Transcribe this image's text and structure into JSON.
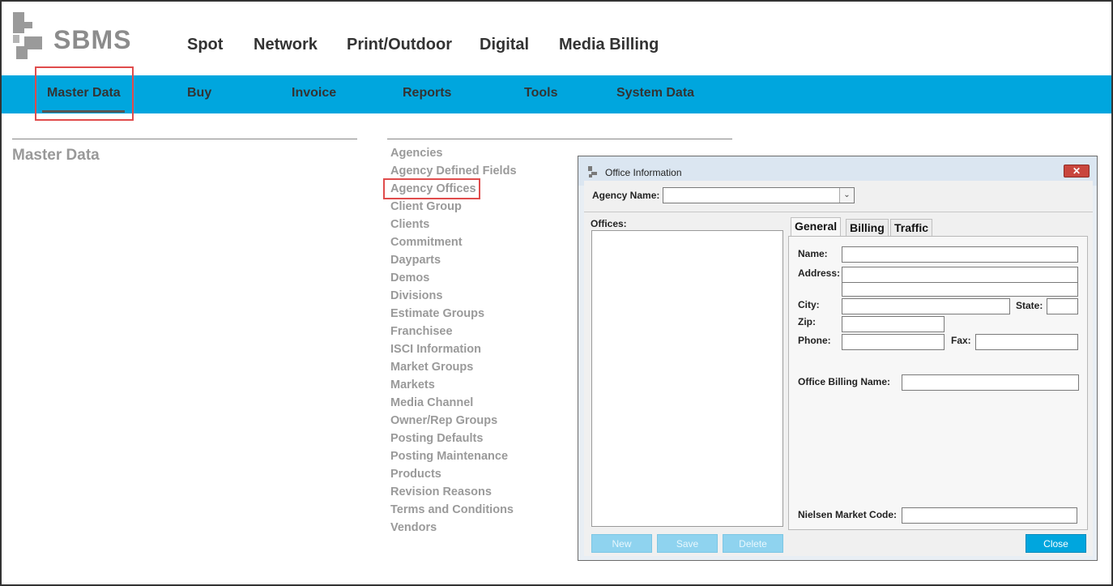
{
  "app": {
    "logo_text": "SBMS"
  },
  "topnav": [
    "Spot",
    "Network",
    "Print/Outdoor",
    "Digital",
    "Media Billing"
  ],
  "subnav": [
    "Master Data",
    "Buy",
    "Invoice",
    "Reports",
    "Tools",
    "System Data"
  ],
  "section_title": "Master Data",
  "menu": [
    "Agencies",
    "Agency Defined Fields",
    "Agency Offices",
    "Client Group",
    "Clients",
    "Commitment",
    "Dayparts",
    "Demos",
    "Divisions",
    "Estimate Groups",
    "Franchisee",
    "ISCI Information",
    "Market Groups",
    "Markets",
    "Media Channel",
    "Owner/Rep Groups",
    "Posting Defaults",
    "Posting Maintenance",
    "Products",
    "Revision Reasons",
    "Terms and Conditions",
    "Vendors"
  ],
  "dialog": {
    "title": "Office Information",
    "close_glyph": "✕",
    "agency_name_label": "Agency Name:",
    "agency_name_value": "",
    "offices_label": "Offices:",
    "tabs": [
      "General",
      "Billing",
      "Traffic"
    ],
    "fields": {
      "name": "Name:",
      "address": "Address:",
      "city": "City:",
      "state": "State:",
      "zip": "Zip:",
      "phone": "Phone:",
      "fax": "Fax:",
      "office_billing_name": "Office Billing Name:",
      "nielsen_market_code": "Nielsen Market Code:"
    },
    "buttons": {
      "new": "New",
      "save": "Save",
      "delete": "Delete",
      "close": "Close"
    }
  },
  "colors": {
    "accent": "#00a6de",
    "highlight": "#e04c4c",
    "menu_text": "#9a9a9a"
  }
}
